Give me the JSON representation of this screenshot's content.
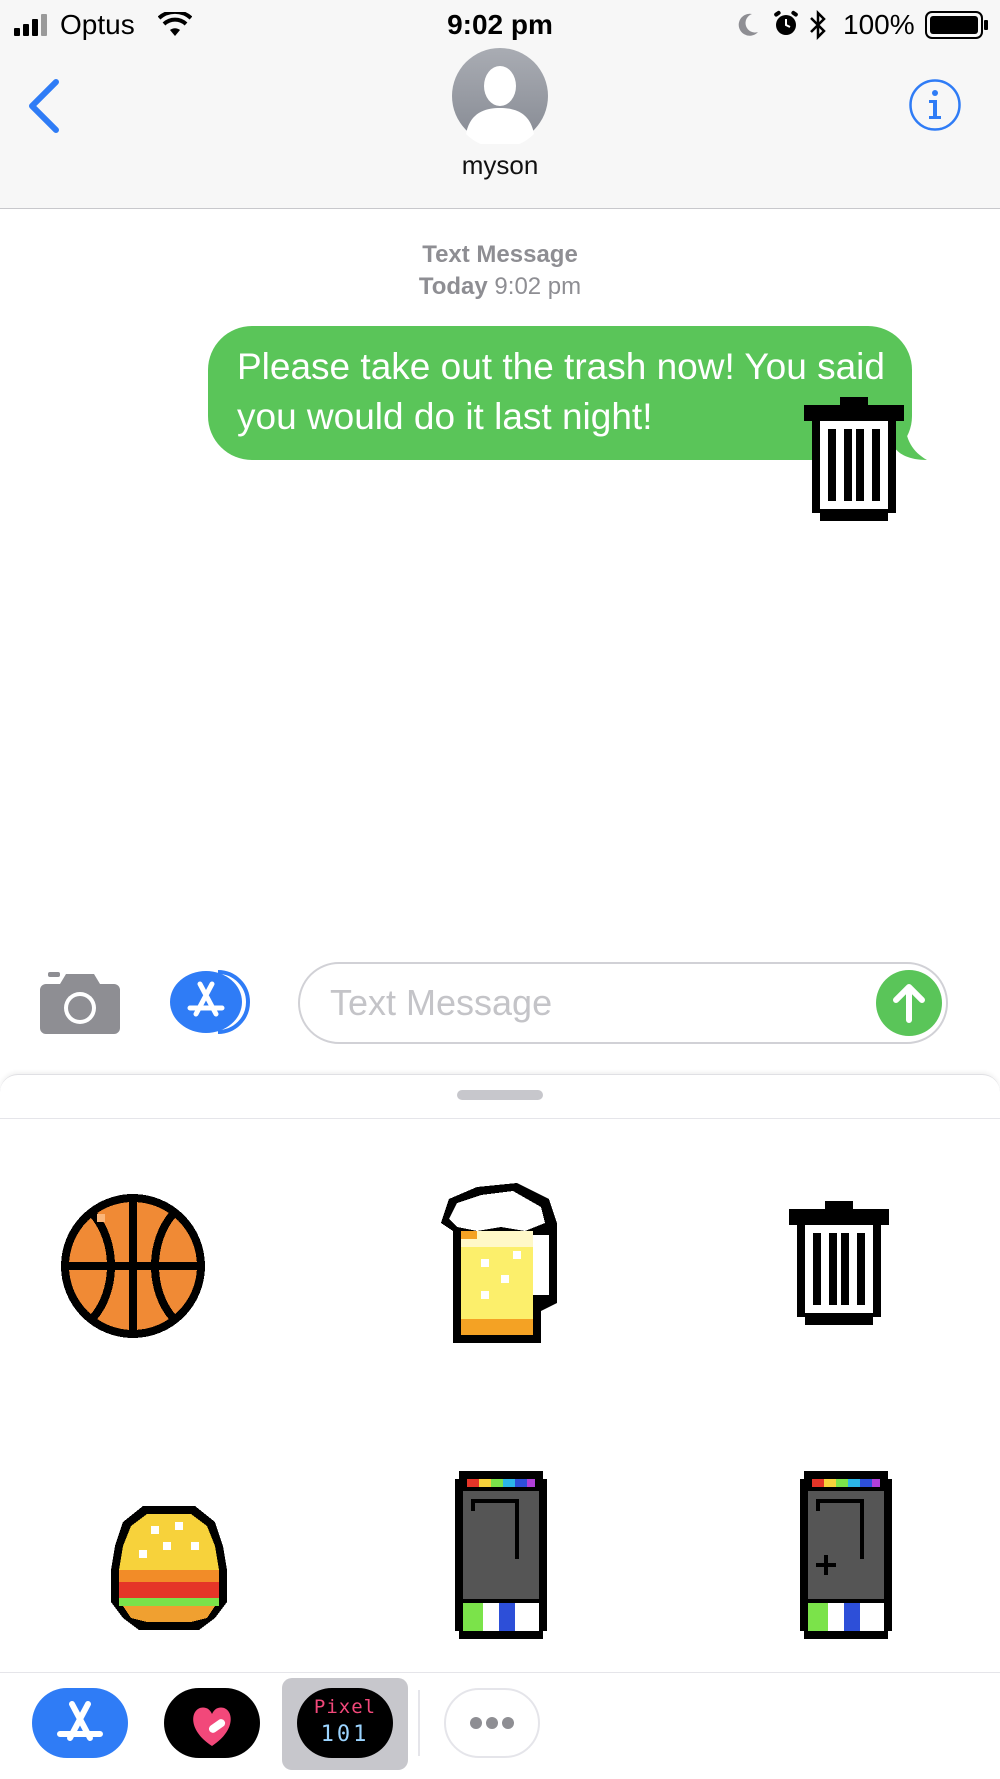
{
  "status_bar": {
    "carrier": "Optus",
    "time": "9:02 pm",
    "battery": "100%"
  },
  "nav": {
    "contact_name": "myson",
    "back_icon": "chevron-left-icon",
    "info_icon": "info-icon",
    "avatar_icon": "person-silhouette-icon"
  },
  "thread": {
    "service_label": "Text Message",
    "date_day": "Today",
    "date_time": "9:02 pm",
    "messages": [
      {
        "text": "Please take out the trash now! You said you would do it last night!",
        "sender": "me",
        "sticker": "trash-can"
      }
    ]
  },
  "compose": {
    "placeholder": "Text Message",
    "camera_icon": "camera-icon",
    "apps_icon": "app-store-icon",
    "send_icon": "send-arrow-icon"
  },
  "sticker_drawer": {
    "stickers": [
      "basketball",
      "beer-mug",
      "trash-can",
      "hamburger",
      "phone",
      "phone-plus"
    ]
  },
  "dock": {
    "apps": [
      "app-store",
      "heart-stickers",
      "pixel-101",
      "more"
    ],
    "pixel_label_top": "Pixel",
    "pixel_label_bottom": "101"
  },
  "colors": {
    "accent_blue": "#2f7cf6",
    "bubble_green": "#5ac559",
    "nav_bg": "#f7f7f7"
  }
}
